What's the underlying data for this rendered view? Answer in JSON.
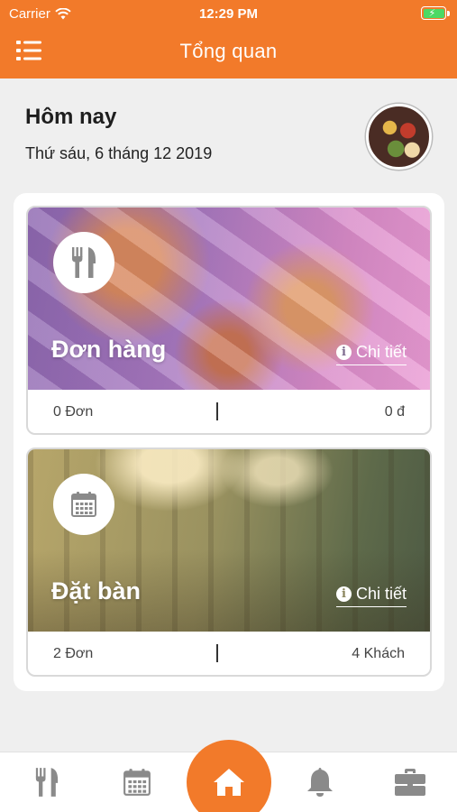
{
  "status_bar": {
    "carrier": "Carrier",
    "time": "12:29 PM"
  },
  "header": {
    "title": "Tổng quan"
  },
  "today": {
    "label": "Hôm nay",
    "date": "Thứ sáu, 6 tháng 12 2019"
  },
  "cards": [
    {
      "title": "Đơn hàng",
      "detail_label": "Chi tiết",
      "icon": "cutlery-icon",
      "left_stat": "0 Đơn",
      "right_stat": "0 đ"
    },
    {
      "title": "Đặt bàn",
      "detail_label": "Chi tiết",
      "icon": "calendar-icon",
      "left_stat": "2 Đơn",
      "right_stat": "4 Khách"
    }
  ],
  "bottom_nav": [
    "cutlery-icon",
    "calendar-icon",
    "home-icon",
    "bell-icon",
    "briefcase-icon"
  ],
  "colors": {
    "accent": "#f27a2a",
    "icon_gray": "#8a8a8a"
  }
}
